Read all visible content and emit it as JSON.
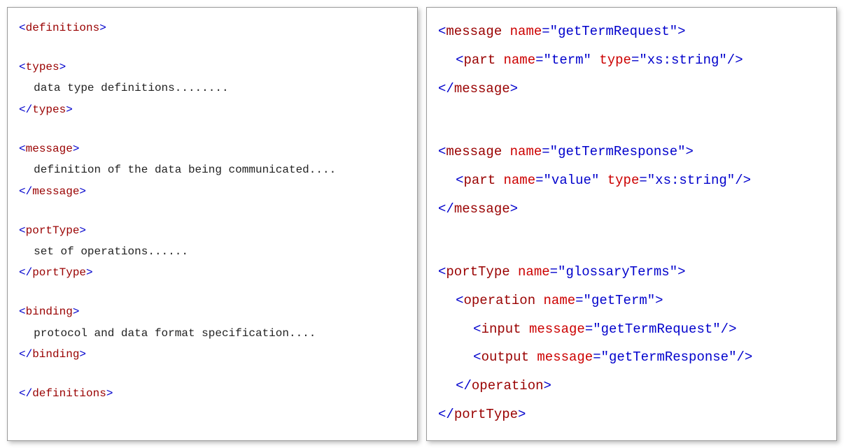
{
  "left": {
    "tags": {
      "definitions_open": "definitions",
      "definitions_close": "definitions",
      "types_open": "types",
      "types_close": "types",
      "message_open": "message",
      "message_close": "message",
      "portType_open": "portType",
      "portType_close": "portType",
      "binding_open": "binding",
      "binding_close": "binding"
    },
    "text": {
      "types_body": "data type definitions........",
      "message_body": "definition of the data being communicated....",
      "portType_body": "set of operations......",
      "binding_body": "protocol and data format specification...."
    }
  },
  "right": {
    "tags": {
      "message": "message",
      "part": "part",
      "portType": "portType",
      "operation": "operation",
      "input": "input",
      "output": "output"
    },
    "attrs": {
      "name": "name",
      "type": "type",
      "message": "message"
    },
    "values": {
      "msg1_name": "getTermRequest",
      "msg1_part_name": "term",
      "msg1_part_type": "xs:string",
      "msg2_name": "getTermResponse",
      "msg2_part_name": "value",
      "msg2_part_type": "xs:string",
      "portType_name": "glossaryTerms",
      "operation_name": "getTerm",
      "input_message": "getTermRequest",
      "output_message": "getTermResponse"
    }
  }
}
